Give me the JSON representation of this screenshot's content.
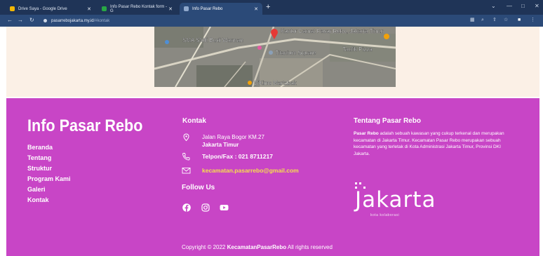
{
  "browser": {
    "tabs": [
      {
        "title": "Drive Saya - Google Drive",
        "active": false,
        "favicon_color": "#f2b705"
      },
      {
        "title": "Info Pasar Rebo Kontak form - G",
        "active": false,
        "favicon_color": "#28a745"
      },
      {
        "title": "Info Pasar Rebo",
        "active": true,
        "favicon_color": "#8fa8cc"
      }
    ],
    "new_tab": "+",
    "url_host": "pasarrebojakarta.my.id",
    "url_path": "/#kontak",
    "controls": {
      "minimize": "—",
      "maximize": "□",
      "close": "✕"
    }
  },
  "map": {
    "labels": [
      "SMA SMK Budi Warman",
      "Kantor Camat Pasar Rebo, Jakarta Timur",
      "Titanium Square",
      "Taufik Pizza",
      "D'Kims Martabak"
    ]
  },
  "footer": {
    "brand": "Info Pasar Rebo",
    "nav": [
      "Beranda",
      "Tentang",
      "Struktur",
      "Program Kami",
      "Galeri",
      "Kontak"
    ],
    "contact": {
      "title": "Kontak",
      "address_line1": "Jalan Raya Bogor KM.27",
      "address_line2": "Jakarta Timur",
      "phone": "Telpon/Fax : 021 8711217",
      "email": "kecamatan.pasarrebo@gmail.com"
    },
    "follow": {
      "title": "Follow Us",
      "icons": [
        "facebook-icon",
        "instagram-icon",
        "youtube-icon"
      ]
    },
    "about": {
      "title": "Tentang Pasar Rebo",
      "bold_lead": "Pasar Rebo",
      "text": " adalah sebuah kawasan yang cukup terkenal dan merupakan kecamatan di Jakarta Timur. Kecamatan Pasar Rebo merupakan sebuah kecamatan yang terletak di Kota Administrasi Jakarta Timur, Provinsi DKI Jakarta."
    },
    "jakarta_logo": {
      "word": "Jakarta",
      "tagline": "kota kolaborasi"
    },
    "copyright": {
      "prefix": "Copyright © 2022 ",
      "owner": "KecamatanPasarRebo",
      "suffix": " All rights reserved"
    }
  },
  "colors": {
    "footer_bg": "#c845c6",
    "email": "#f6e04c",
    "page_bg": "#fbf0e6",
    "browser_chrome": "#1f3457"
  }
}
